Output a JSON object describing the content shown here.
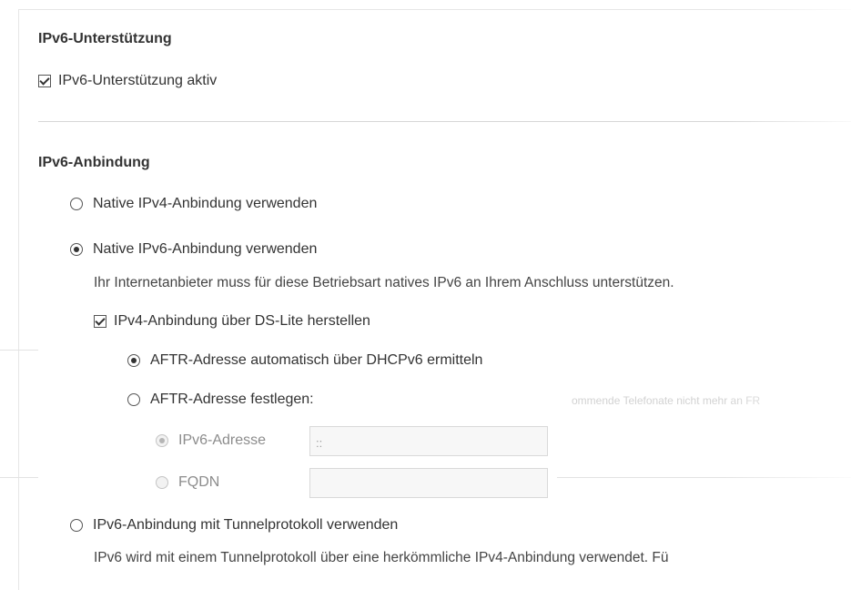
{
  "support": {
    "heading": "IPv6-Unterstützung",
    "checkbox_label": "IPv6-Unterstützung aktiv",
    "checkbox_checked": true
  },
  "connection": {
    "heading": "IPv6-Anbindung",
    "native_ipv4": {
      "label": "Native IPv4-Anbindung verwenden",
      "selected": false
    },
    "native_ipv6": {
      "label": "Native IPv6-Anbindung verwenden",
      "selected": true,
      "description": "Ihr Internetanbieter muss für diese Betriebsart natives IPv6 an Ihrem Anschluss unterstützen.",
      "dslite": {
        "label": "IPv4-Anbindung über DS-Lite herstellen",
        "checked": true
      },
      "aftr_auto": {
        "label": "AFTR-Adresse automatisch über DHCPv6 ermitteln",
        "selected": true
      },
      "aftr_manual": {
        "label": "AFTR-Adresse festlegen:",
        "selected": false
      },
      "ipv6_address": {
        "label": "IPv6-Adresse",
        "value": "::",
        "selected": true
      },
      "fqdn": {
        "label": "FQDN",
        "value": "",
        "selected": false
      }
    },
    "tunnel": {
      "label": "IPv6-Anbindung mit Tunnelprotokoll verwenden",
      "selected": false,
      "description": "IPv6 wird mit einem Tunnelprotokoll über eine herkömmliche IPv4-Anbindung verwendet. Fü"
    }
  },
  "background": {
    "ghost_text": "ommende Telefonate nicht mehr an FR"
  },
  "colors": {
    "text": "#333333",
    "divider": "#d6d6d6",
    "disabled": "#8c8c8c"
  }
}
